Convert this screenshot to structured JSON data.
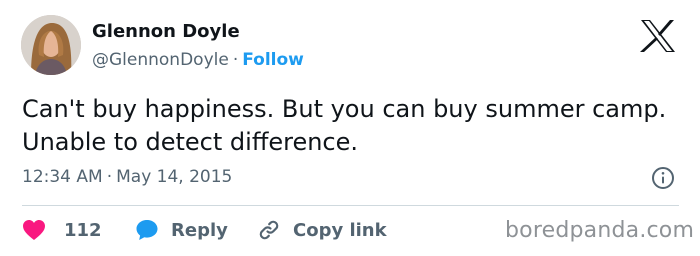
{
  "author": {
    "name": "Glennon Doyle",
    "handle": "@GlennonDoyle",
    "separator": "·",
    "follow_label": "Follow",
    "avatar_icon": "profile-photo"
  },
  "tweet": {
    "text": "Can't buy happiness. But you can buy summer camp. Unable to detect difference.",
    "time": "12:34 AM",
    "separator": "·",
    "date": "May 14, 2015"
  },
  "actions": {
    "like_count": "112",
    "reply_label": "Reply",
    "copy_label": "Copy link"
  },
  "watermark": "boredpanda.com",
  "colors": {
    "accent": "#1d9bf0",
    "like": "#f91880",
    "muted": "#536471",
    "text": "#0f1419"
  }
}
